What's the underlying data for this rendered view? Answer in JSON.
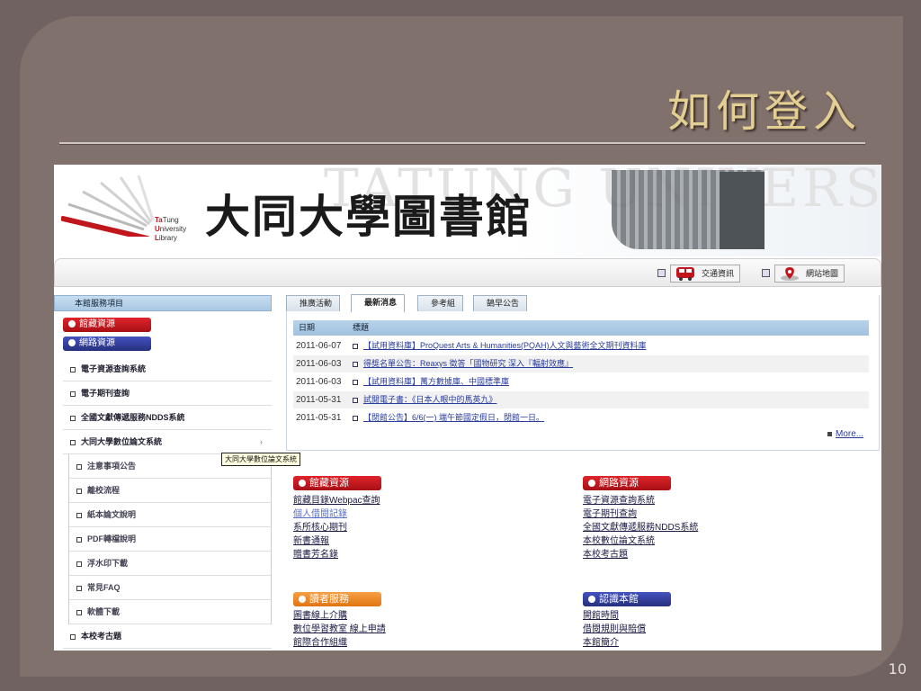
{
  "slide": {
    "title": "如何登入",
    "page_number": "10"
  },
  "banner": {
    "logo_lines": [
      "Ta",
      "Tung",
      "U",
      "niversity",
      "L",
      "ibrary"
    ],
    "title": "大同大學圖書館",
    "watermark": "TATUNG UNIVERSITY LIBRARY"
  },
  "topnav": {
    "traffic": "交通資訊",
    "sitemap": "網站地圖"
  },
  "sidebar": {
    "header": "本館服務項目",
    "cat_collection": "館藏資源",
    "cat_network": "網路資源",
    "items": [
      {
        "label": "電子資源查詢系統"
      },
      {
        "label": "電子期刊查詢"
      },
      {
        "label": "全國文獻傳遞服務NDDS系統"
      },
      {
        "label": "大同大學數位論文系統",
        "arrow": "›"
      }
    ],
    "sub_items": [
      {
        "label": "注意事項公告"
      },
      {
        "label": "離校流程"
      },
      {
        "label": "紙本論文說明"
      },
      {
        "label": "PDF轉檔說明"
      },
      {
        "label": "浮水印下載"
      },
      {
        "label": "常見FAQ"
      },
      {
        "label": "軟體下載"
      }
    ],
    "last_item": "本校考古題",
    "tooltip": "大同大學數位論文系統"
  },
  "news": {
    "tabs": [
      "推廣活動",
      "最新消息",
      "參考組",
      "鵠早公告"
    ],
    "col_date": "日期",
    "col_title": "標題",
    "rows": [
      {
        "date": "2011-06-07",
        "title": "【試用資料庫】ProQuest Arts & Humanities(PQAH)人文與藝術全文期刊資料庫"
      },
      {
        "date": "2011-06-03",
        "title": "得獎名單公告：Reaxys 徵答「國物研究 深入『輻射效應』"
      },
      {
        "date": "2011-06-03",
        "title": "【試用資料庫】萬方數據庫、中國標準庫"
      },
      {
        "date": "2011-05-31",
        "title": "試閱電子書：《日本人眼中的馬英九》"
      },
      {
        "date": "2011-05-31",
        "title": "【閉館公告】6/6(一) 端午節國定假日，閉館一日。"
      }
    ],
    "more": "More..."
  },
  "blocks": {
    "collection": {
      "label": "館藏資源",
      "links": [
        "館藏目錄Webpac查詢",
        "個人借閱記錄",
        "系所核心期刊",
        "新書通報",
        "贈書芳名錄"
      ]
    },
    "network": {
      "label": "網路資源",
      "links": [
        "電子資源查詢系統",
        "電子期刊查詢",
        "全國文獻傳遞服務NDDS系統",
        "本校數位論文系統",
        "本校考古題"
      ]
    },
    "reader": {
      "label": "讀者服務",
      "links": [
        "圖書線上介購",
        "數位學習教室 線上申請",
        "館際合作組織"
      ]
    },
    "about": {
      "label": "認識本館",
      "links": [
        "開館時間",
        "借閱規則與賠償",
        "本館簡介"
      ]
    }
  },
  "colors": {
    "background": "#6f6260",
    "frame": "#81716d",
    "title_gold": "#e4cf93",
    "red": "#c0161c",
    "blue": "#25307d",
    "orange": "#e07411",
    "link": "#2a3d9a"
  }
}
